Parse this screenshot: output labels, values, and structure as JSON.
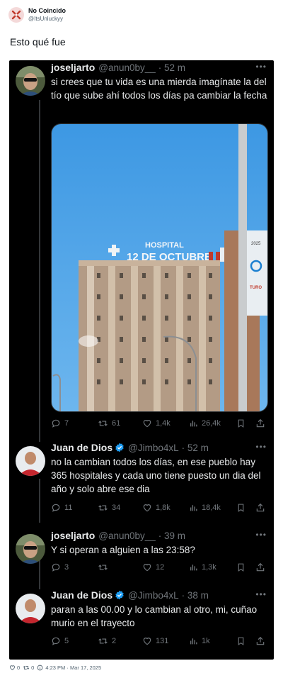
{
  "outer": {
    "name": "No Coincido",
    "handle": "@ItsUnluckyy",
    "text": "Esto qué fue",
    "footer": {
      "likes": "0",
      "retweets": "0",
      "timestamp": "4:23 PM · Mar 17, 2025"
    }
  },
  "tweets": [
    {
      "name": "joseljarto",
      "handle": "@anun0by__",
      "time": "· 52 m",
      "text": "si crees que tu vida es una mierda imagínate la del tío que sube ahí todos los días pa cambiar la fecha",
      "verified": false,
      "replies": "7",
      "retweets": "61",
      "likes": "1,4k",
      "views": "26,4k"
    },
    {
      "name": "Juan de Dios",
      "handle": "@Jimbo4xL",
      "time": "· 52 m",
      "text": "no la cambian todos los días, en ese pueblo hay 365 hospitales y cada uno tiene puesto un dia del año y solo abre ese dia",
      "verified": true,
      "replies": "11",
      "retweets": "34",
      "likes": "1,8k",
      "views": "18,4k"
    },
    {
      "name": "joseljarto",
      "handle": "@anun0by__",
      "time": "· 39 m",
      "text": "Y si operan a alguien a las 23:58?",
      "verified": false,
      "replies": "3",
      "retweets": "",
      "likes": "12",
      "views": "1,3k"
    },
    {
      "name": "Juan de Dios",
      "handle": "@Jimbo4xL",
      "time": "· 38 m",
      "text": "paran a las 00.00 y lo cambian al otro, mi, cuñao murio en el trayecto",
      "verified": true,
      "replies": "5",
      "retweets": "2",
      "likes": "131",
      "views": "1k"
    }
  ],
  "photo": {
    "sign_line1": "HOSPITAL",
    "sign_line2": "12 DE OCTUBRE",
    "side_text1": "2025",
    "side_text2": "TURO"
  },
  "colors": {
    "card_bg": "#000000",
    "text_primary": "#e7e9ea",
    "text_secondary": "#71767b",
    "verified": "#1d9bf0",
    "sky": "#4ea3e6"
  }
}
